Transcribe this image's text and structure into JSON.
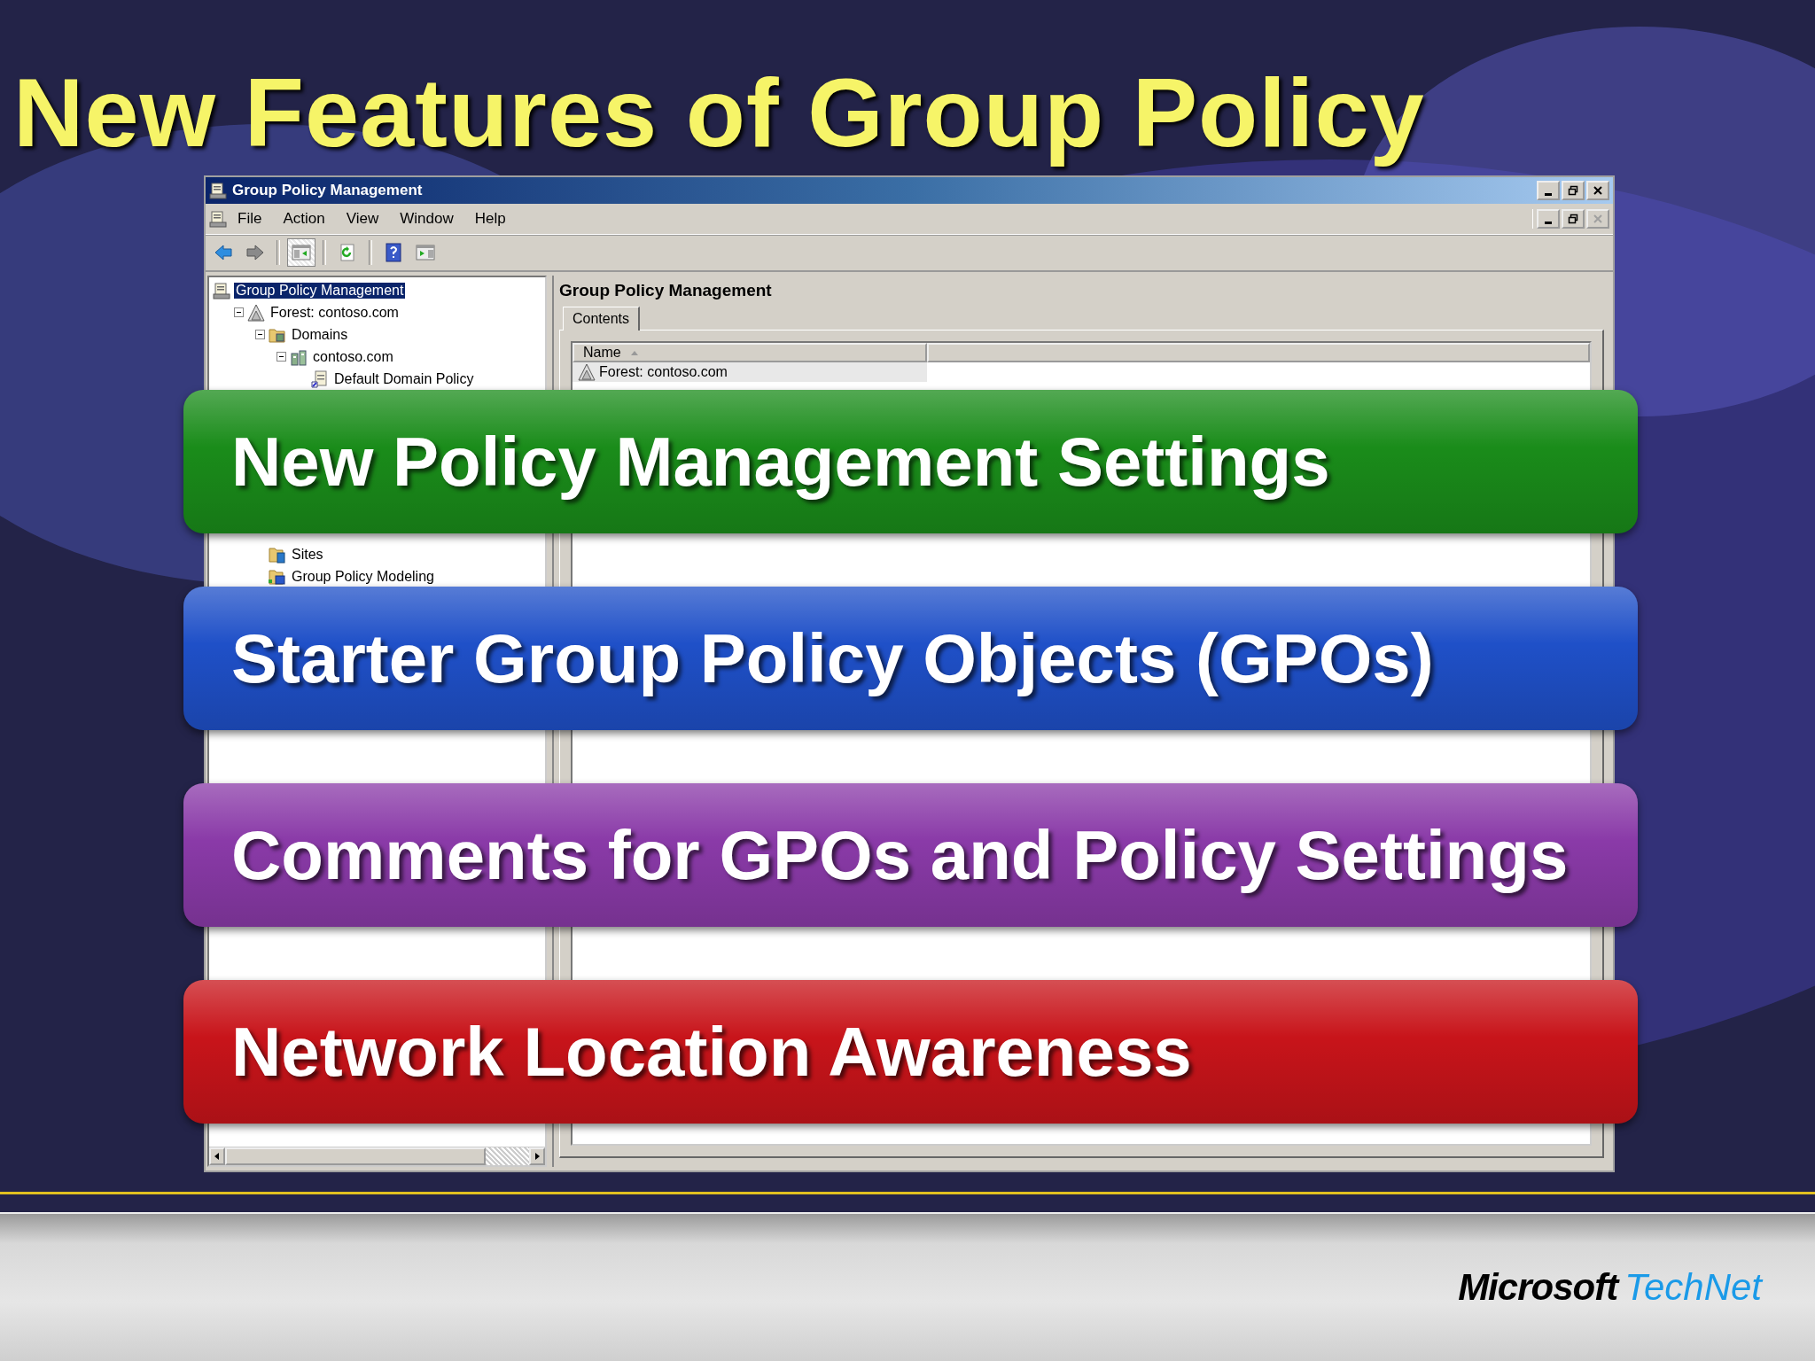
{
  "slide": {
    "title": "New Features of Group Policy"
  },
  "window": {
    "title": "Group Policy Management"
  },
  "menu": [
    {
      "label": "File"
    },
    {
      "label": "Action"
    },
    {
      "label": "View"
    },
    {
      "label": "Window"
    },
    {
      "label": "Help"
    }
  ],
  "toolbar": [
    {
      "kind": "back",
      "pressed": false
    },
    {
      "kind": "forward",
      "pressed": false
    },
    {
      "kind": "separator"
    },
    {
      "kind": "tree",
      "pressed": true
    },
    {
      "kind": "separator"
    },
    {
      "kind": "refresh",
      "pressed": false
    },
    {
      "kind": "separator"
    },
    {
      "kind": "help",
      "pressed": false
    },
    {
      "kind": "actions",
      "pressed": false
    }
  ],
  "tree": [
    {
      "label": "Group Policy Management",
      "kind": "console",
      "selected": true,
      "children": [
        {
          "label": "Forest: contoso.com",
          "kind": "forest",
          "selected": false,
          "expanded": true,
          "children": [
            {
              "label": "Domains",
              "kind": "domains",
              "selected": false,
              "expanded": true,
              "children": [
                {
                  "label": "contoso.com",
                  "kind": "domain",
                  "selected": false,
                  "expanded": true,
                  "children": [
                    {
                      "label": "Default Domain Policy",
                      "kind": "gpo",
                      "selected": false
                    }
                  ]
                }
              ]
            },
            {
              "label": "Sites",
              "kind": "sites",
              "selected": false
            },
            {
              "label": "Group Policy Modeling",
              "kind": "modeling",
              "selected": false
            }
          ]
        }
      ]
    }
  ],
  "details": {
    "heading": "Group Policy Management",
    "tabs": [
      {
        "label": "Contents",
        "selected": true
      }
    ],
    "columns": [
      {
        "label": "Name",
        "sorted": true
      }
    ],
    "rows": [
      {
        "name": "Forest: contoso.com",
        "kind": "forest"
      }
    ]
  },
  "banners": [
    {
      "text": "New Policy Management Settings",
      "color": "#1a8c1a"
    },
    {
      "text": "Starter Group Policy Objects (GPOs)",
      "color": "#1f50c8"
    },
    {
      "text": "Comments for GPOs and Policy Settings",
      "color": "#8a3aa8"
    },
    {
      "text": "Network Location Awareness",
      "color": "#c8141a"
    }
  ],
  "footer": {
    "logo_brand": "Microsoft",
    "logo_product": "TechNet"
  }
}
